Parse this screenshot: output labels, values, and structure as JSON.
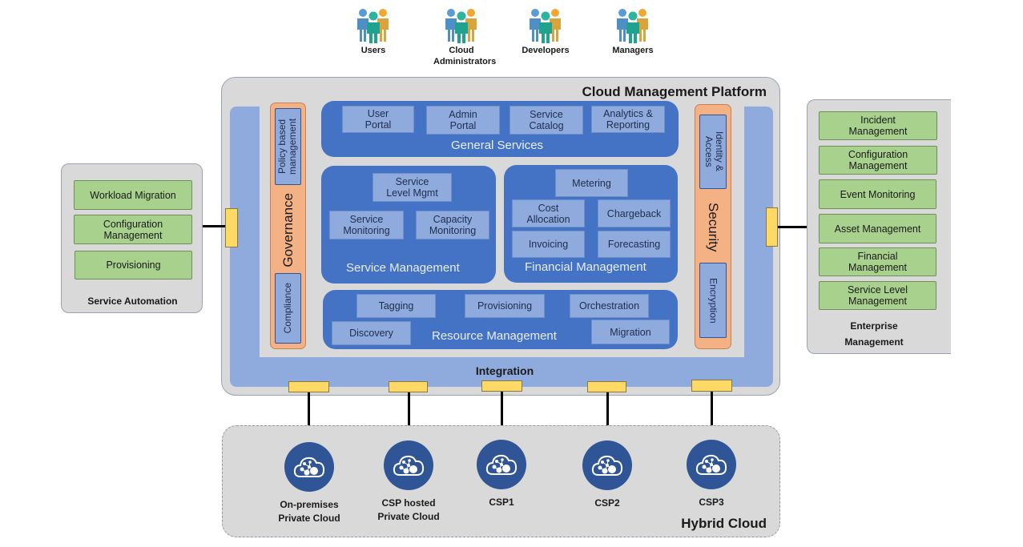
{
  "personas": [
    {
      "label": "Users",
      "icon": "people-group-icon"
    },
    {
      "label": "Cloud Administrators",
      "icon": "people-group-icon"
    },
    {
      "label": "Developers",
      "icon": "people-group-icon"
    },
    {
      "label": "Managers",
      "icon": "people-group-icon"
    }
  ],
  "platform": {
    "title": "Cloud Management Platform",
    "integration_label": "Integration",
    "governance": {
      "title": "Governance",
      "items": [
        "Policy based management",
        "Compliance"
      ]
    },
    "security": {
      "title": "Security",
      "items": [
        "Identity & Access",
        "Encryption"
      ]
    },
    "general_services": {
      "title": "General Services",
      "items": [
        "User\nPortal",
        "Admin\nPortal",
        "Service\nCatalog",
        "Analytics &\nReporting"
      ]
    },
    "service_management": {
      "title": "Service Management",
      "items": [
        "Service\nLevel Mgmt",
        "Service\nMonitoring",
        "Capacity\nMonitoring"
      ]
    },
    "financial_management": {
      "title": "Financial Management",
      "items": [
        "Metering",
        "Cost\nAllocation",
        "Chargeback",
        "Invoicing",
        "Forecasting"
      ]
    },
    "resource_management": {
      "title": "Resource Management",
      "items": [
        "Tagging",
        "Provisioning",
        "Orchestration",
        "Discovery",
        "Migration"
      ]
    }
  },
  "service_automation": {
    "title": "Service Automation",
    "items": [
      "Workload Migration",
      "Configuration\nManagement",
      "Provisioning"
    ]
  },
  "enterprise_management": {
    "title": "Enterprise\nManagement",
    "items": [
      "Incident\nManagement",
      "Configuration\nManagement",
      "Event Monitoring",
      "Asset Management",
      "Financial\nManagement",
      "Service Level\nManagement"
    ]
  },
  "hybrid_cloud": {
    "title": "Hybrid Cloud",
    "nodes": [
      {
        "label": "On-premises\nPrivate Cloud",
        "icon": "cloud-network-icon"
      },
      {
        "label": "CSP hosted\nPrivate Cloud",
        "icon": "cloud-network-icon"
      },
      {
        "label": "CSP1",
        "icon": "cloud-network-icon"
      },
      {
        "label": "CSP2",
        "icon": "cloud-network-icon"
      },
      {
        "label": "CSP3",
        "icon": "cloud-network-icon"
      }
    ]
  },
  "colors": {
    "group_blue": "#4472c4",
    "tile_blue": "#8faadc",
    "orange": "#f4b183",
    "green": "#a9d18e",
    "connector_yellow": "#ffd966",
    "panel_grey": "#d9d9d9",
    "node_blue": "#2f5597"
  }
}
